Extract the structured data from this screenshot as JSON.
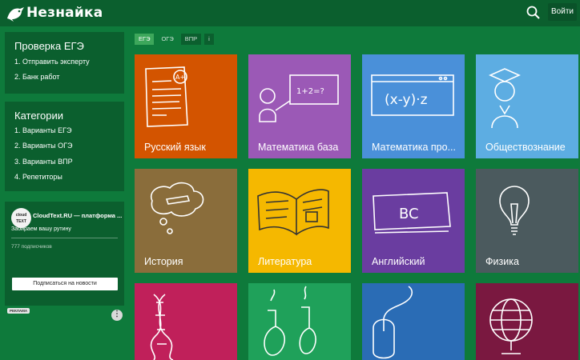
{
  "header": {
    "brand": "Незнайка",
    "login_label": "Войти"
  },
  "sidebar": {
    "ege_panel": {
      "title": "Проверка ЕГЭ",
      "items": [
        "1. Отправить эксперту",
        "2. Банк работ"
      ]
    },
    "categories_panel": {
      "title": "Категории",
      "items": [
        "1. Варианты ЕГЭ",
        "2. Варианты ОГЭ",
        "3. Варианты ВПР",
        "4. Репетиторы"
      ]
    },
    "ad": {
      "avatar_text": "ctoud TEXT",
      "name": "CloudText.RU — платформа ...",
      "tagline": "Забираем вашу рутину",
      "subscribers": "777 подписчиков",
      "subscribe_label": "Подписаться на новости",
      "ad_tag": "РЕКЛАМА",
      "more": "⋮"
    }
  },
  "exam_tabs": [
    {
      "label": "ЕГЭ",
      "active": true
    },
    {
      "label": "ОГЭ",
      "active": false
    },
    {
      "label": "ВПР",
      "active": false
    },
    {
      "label": "i",
      "active": false
    }
  ],
  "subjects": [
    {
      "label": "Русский язык",
      "color": "#d35400",
      "icon": "essay-icon"
    },
    {
      "label": "Математика база",
      "color": "#9b59b6",
      "icon": "teacher-board-icon"
    },
    {
      "label": "Математика про...",
      "color": "#4a90d9",
      "icon": "formula-window-icon"
    },
    {
      "label": "Обществознание",
      "color": "#5dade2",
      "icon": "graduate-icon"
    },
    {
      "label": "История",
      "color": "#8a6d3b",
      "icon": "thought-cloud-icon"
    },
    {
      "label": "Литература",
      "color": "#f5b800",
      "icon": "open-book-icon"
    },
    {
      "label": "Английский",
      "color": "#6a3da0",
      "icon": "abc-board-icon"
    },
    {
      "label": "Физика",
      "color": "#4b5a5e",
      "icon": "lightbulb-icon"
    },
    {
      "label": "",
      "color": "#c0205a",
      "icon": "dna-icon"
    },
    {
      "label": "",
      "color": "#1fa15a",
      "icon": "flasks-icon"
    },
    {
      "label": "",
      "color": "#2a6cb5",
      "icon": "mouse-icon"
    },
    {
      "label": "",
      "color": "#7a1840",
      "icon": "globe-icon"
    }
  ]
}
